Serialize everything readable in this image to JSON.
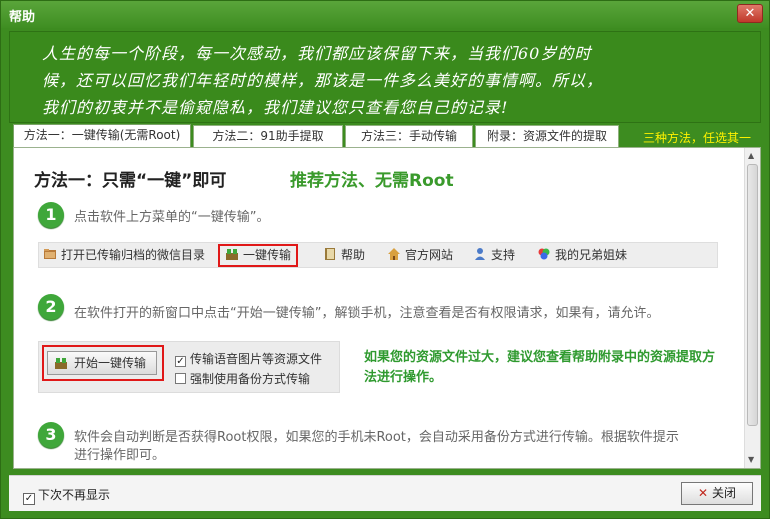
{
  "window": {
    "title": "帮助"
  },
  "banner": {
    "lines": [
      "人生的每一个阶段，每一次感动，我们都应该保留下来，当我们60岁的时",
      "候，还可以回忆我们年轻时的模样，那该是一件多么美好的事情啊。所以，",
      "我们的初衷并不是偷窥隐私，我们建议您只查看您自己的记录!"
    ]
  },
  "tabs": [
    {
      "label": "方法一：一键传输(无需Root)",
      "active": true
    },
    {
      "label": "方法二：91助手提取",
      "active": false
    },
    {
      "label": "方法三：手动传输",
      "active": false
    },
    {
      "label": "附录：资源文件的提取",
      "active": false
    }
  ],
  "tab_hint": "三种方法，任选其一",
  "content": {
    "heading": "方法一：只需“一键”即可",
    "heading_sub": "推荐方法、无需Root",
    "step1": {
      "num": "1",
      "text": "点击软件上方菜单的“一键传输”。"
    },
    "toolbar": [
      {
        "label": "打开已传输归档的微信目录",
        "icon": "folder-icon"
      },
      {
        "label": "一键传输",
        "icon": "transfer-icon"
      },
      {
        "label": "帮助",
        "icon": "book-icon"
      },
      {
        "label": "官方网站",
        "icon": "home-icon"
      },
      {
        "label": "支持",
        "icon": "user-icon"
      },
      {
        "label": "我的兄弟姐妹",
        "icon": "colorwheel-icon"
      }
    ],
    "step2": {
      "num": "2",
      "text": "在软件打开的新窗口中点击“开始一键传输”，解锁手机，注意查看是否有权限请求，如果有，请允许。"
    },
    "dialog": {
      "start_button": "开始一键传输",
      "check1": "传输语音图片等资源文件",
      "check2": "强制使用备份方式传输"
    },
    "advice": "如果您的资源文件过大，建议您查看帮助附录中的资源提取方法进行操作。",
    "step3": {
      "num": "3",
      "text_l1": "软件会自动判断是否获得Root权限，如果您的手机未Root，会自动采用备份方式进行传输。根据软件提示",
      "text_l2": "进行操作即可。"
    }
  },
  "footer": {
    "dont_show": "下次不再显示",
    "close_button": "关闭"
  },
  "colors": {
    "brand_green": "#3d8c20",
    "accent_green": "#3fa73a",
    "highlight_red": "#e01818",
    "hint_yellow": "#fff200"
  }
}
